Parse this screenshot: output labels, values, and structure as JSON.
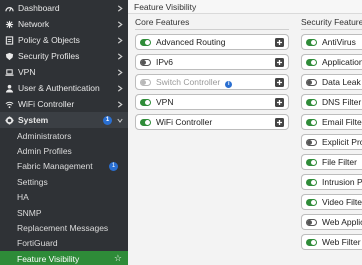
{
  "sidebar": {
    "items": [
      {
        "label": "Dashboard",
        "icon": "dashboard-icon"
      },
      {
        "label": "Network",
        "icon": "network-icon"
      },
      {
        "label": "Policy & Objects",
        "icon": "policy-icon"
      },
      {
        "label": "Security Profiles",
        "icon": "shield-icon"
      },
      {
        "label": "VPN",
        "icon": "laptop-icon"
      },
      {
        "label": "User & Authentication",
        "icon": "user-icon"
      },
      {
        "label": "WiFi Controller",
        "icon": "wifi-icon"
      }
    ],
    "system": {
      "label": "System",
      "icon": "gear-icon",
      "badge": "1"
    },
    "subitems": [
      {
        "label": "Administrators"
      },
      {
        "label": "Admin Profiles"
      },
      {
        "label": "Fabric Management",
        "badge": "1"
      },
      {
        "label": "Settings"
      },
      {
        "label": "HA"
      },
      {
        "label": "SNMP"
      },
      {
        "label": "Replacement Messages"
      },
      {
        "label": "FortiGuard"
      },
      {
        "label": "Feature Visibility",
        "active": true
      }
    ]
  },
  "page": {
    "title": "Feature Visibility"
  },
  "core": {
    "header": "Core Features",
    "features": [
      {
        "label": "Advanced Routing",
        "state": "on"
      },
      {
        "label": "IPv6",
        "state": "off"
      },
      {
        "label": "Switch Controller",
        "state": "disabled",
        "info": "i"
      },
      {
        "label": "VPN",
        "state": "on"
      },
      {
        "label": "WiFi Controller",
        "state": "on"
      }
    ]
  },
  "security": {
    "header": "Security Features",
    "features": [
      {
        "label": "AntiVirus",
        "state": "on"
      },
      {
        "label": "Application C",
        "state": "on"
      },
      {
        "label": "Data Leak Pr",
        "state": "off"
      },
      {
        "label": "DNS Filter",
        "state": "on"
      },
      {
        "label": "Email Filter",
        "state": "on"
      },
      {
        "label": "Explicit Proxy",
        "state": "off"
      },
      {
        "label": "File Filter",
        "state": "on"
      },
      {
        "label": "Intrusion Pre",
        "state": "on"
      },
      {
        "label": "Video Filter",
        "state": "on"
      },
      {
        "label": "Web Applicat",
        "state": "off"
      },
      {
        "label": "Web Filter",
        "state": "on"
      }
    ]
  },
  "colors": {
    "sidebar_bg": "#2f3236",
    "accent_green": "#2e8b38",
    "badge_blue": "#2a6fd1"
  }
}
